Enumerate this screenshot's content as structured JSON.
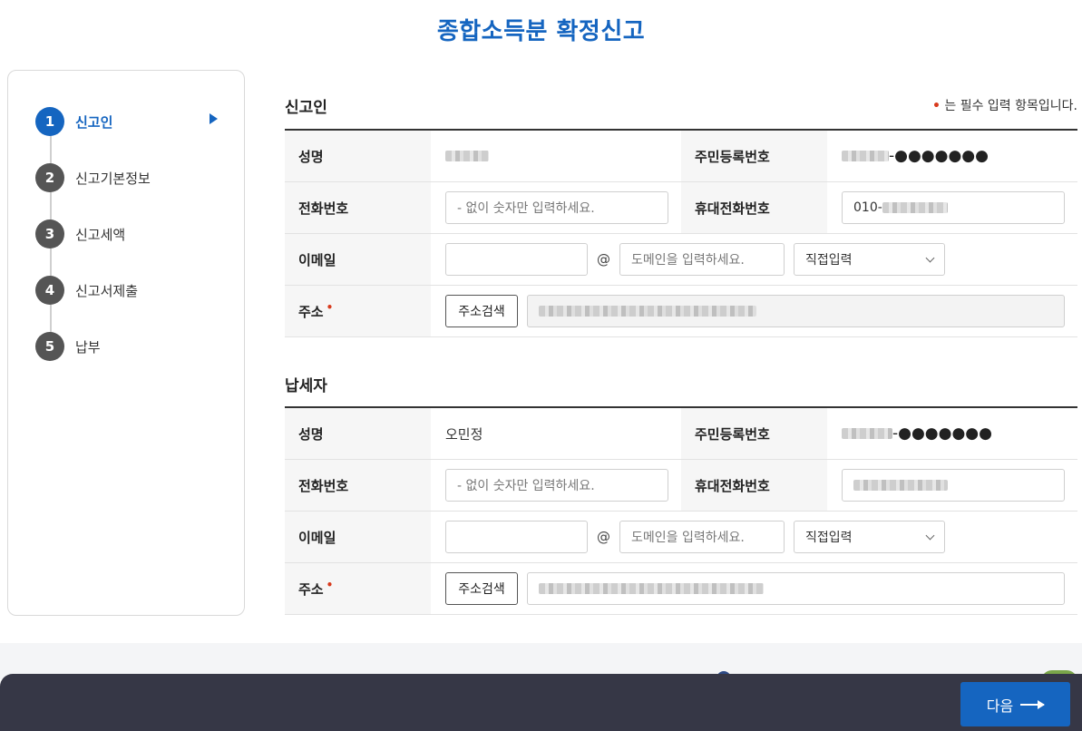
{
  "page_title": "종합소득분 확정신고",
  "steps": [
    {
      "num": "1",
      "label": "신고인"
    },
    {
      "num": "2",
      "label": "신고기본정보"
    },
    {
      "num": "3",
      "label": "신고세액"
    },
    {
      "num": "4",
      "label": "신고서제출"
    },
    {
      "num": "5",
      "label": "납부"
    }
  ],
  "required_note": "는 필수 입력 항목입니다.",
  "required_mark": "•",
  "reporter": {
    "title": "신고인",
    "name_label": "성명",
    "rrn_label": "주민등록번호",
    "rrn_suffix": "-●●●●●●●",
    "phone_label": "전화번호",
    "phone_placeholder": "- 없이 숫자만 입력하세요.",
    "mobile_label": "휴대전화번호",
    "mobile_prefix": "010-",
    "email_label": "이메일",
    "at": "@",
    "domain_placeholder": "도메인을 입력하세요.",
    "domain_select": "직접입력",
    "address_label": "주소",
    "address_search": "주소검색"
  },
  "taxpayer": {
    "title": "납세자",
    "name_label": "성명",
    "name_value": "오민정",
    "rrn_label": "주민등록번호",
    "rrn_suffix": "-●●●●●●●",
    "phone_label": "전화번호",
    "phone_placeholder": "- 없이 숫자만 입력하세요.",
    "mobile_label": "휴대전화번호",
    "email_label": "이메일",
    "at": "@",
    "domain_placeholder": "도메인을 입력하세요.",
    "domain_select": "직접입력",
    "address_label": "주소",
    "address_search": "주소검색"
  },
  "next_button": "다음"
}
